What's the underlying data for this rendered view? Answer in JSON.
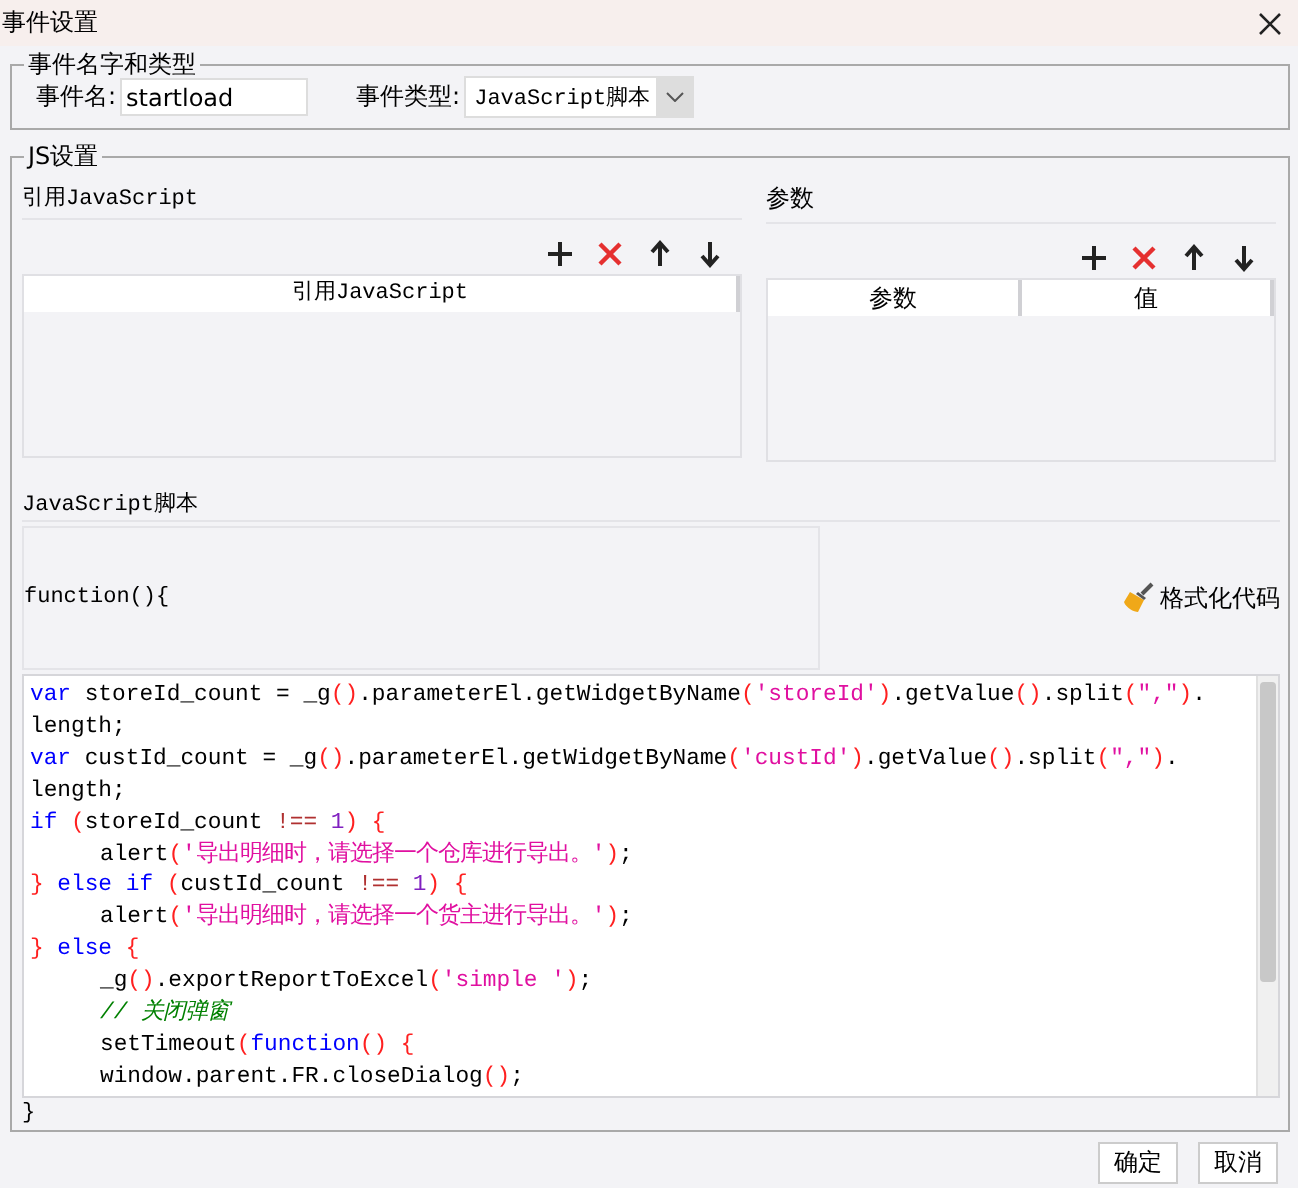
{
  "window": {
    "title": "事件设置"
  },
  "event_group": {
    "title": "事件名字和类型",
    "name_label": "事件名:",
    "name_value": "startload",
    "type_label": "事件类型:",
    "type_value": "JavaScript脚本"
  },
  "js_group": {
    "title": "JS设置",
    "references": {
      "title": "引用JavaScript",
      "columns": [
        "引用JavaScript"
      ]
    },
    "parameters": {
      "title": "参数",
      "columns": [
        "参数",
        "值"
      ]
    },
    "script": {
      "title": "JavaScript脚本",
      "header": "function(){",
      "format_button": "格式化代码",
      "footer": "}",
      "lines": [
        {
          "indent": false,
          "tokens": [
            {
              "kind": "kw",
              "text": "var"
            },
            {
              "kind": "plain",
              "text": " storeId_count = _g"
            },
            {
              "kind": "paren",
              "text": "()"
            },
            {
              "kind": "plain",
              "text": ".parameterEl.getWidgetByName"
            },
            {
              "kind": "paren",
              "text": "("
            },
            {
              "kind": "str",
              "text": "'storeId'"
            },
            {
              "kind": "paren",
              "text": ")"
            },
            {
              "kind": "plain",
              "text": ".getValue"
            },
            {
              "kind": "paren",
              "text": "()"
            },
            {
              "kind": "plain",
              "text": ".split"
            },
            {
              "kind": "paren",
              "text": "("
            },
            {
              "kind": "str",
              "text": "\",\""
            },
            {
              "kind": "paren",
              "text": ")"
            },
            {
              "kind": "plain",
              "text": "."
            }
          ]
        },
        {
          "indent": false,
          "tokens": [
            {
              "kind": "plain",
              "text": "length;"
            }
          ]
        },
        {
          "indent": false,
          "tokens": [
            {
              "kind": "kw",
              "text": "var"
            },
            {
              "kind": "plain",
              "text": " custId_count = _g"
            },
            {
              "kind": "paren",
              "text": "()"
            },
            {
              "kind": "plain",
              "text": ".parameterEl.getWidgetByName"
            },
            {
              "kind": "paren",
              "text": "("
            },
            {
              "kind": "str",
              "text": "'custId'"
            },
            {
              "kind": "paren",
              "text": ")"
            },
            {
              "kind": "plain",
              "text": ".getValue"
            },
            {
              "kind": "paren",
              "text": "()"
            },
            {
              "kind": "plain",
              "text": ".split"
            },
            {
              "kind": "paren",
              "text": "("
            },
            {
              "kind": "str",
              "text": "\",\""
            },
            {
              "kind": "paren",
              "text": ")"
            },
            {
              "kind": "plain",
              "text": "."
            }
          ]
        },
        {
          "indent": false,
          "tokens": [
            {
              "kind": "plain",
              "text": "length;"
            }
          ]
        },
        {
          "indent": false,
          "tokens": [
            {
              "kind": "kw",
              "text": "if"
            },
            {
              "kind": "paren",
              "text": " ("
            },
            {
              "kind": "plain",
              "text": "storeId_count "
            },
            {
              "kind": "op",
              "text": "!=="
            },
            {
              "kind": "num",
              "text": " 1"
            },
            {
              "kind": "paren",
              "text": ")"
            },
            {
              "kind": "paren",
              "text": " {"
            }
          ]
        },
        {
          "indent": true,
          "tokens": [
            {
              "kind": "plain",
              "text": "alert"
            },
            {
              "kind": "paren",
              "text": "("
            },
            {
              "kind": "str",
              "text": "'导出明细时，请选择一个仓库进行导出。'"
            },
            {
              "kind": "paren",
              "text": ")"
            },
            {
              "kind": "plain",
              "text": ";"
            }
          ]
        },
        {
          "indent": false,
          "tokens": [
            {
              "kind": "paren",
              "text": "}"
            },
            {
              "kind": "kw",
              "text": " else if"
            },
            {
              "kind": "paren",
              "text": " ("
            },
            {
              "kind": "plain",
              "text": "custId_count "
            },
            {
              "kind": "op",
              "text": "!=="
            },
            {
              "kind": "num",
              "text": " 1"
            },
            {
              "kind": "paren",
              "text": ")"
            },
            {
              "kind": "paren",
              "text": " {"
            }
          ]
        },
        {
          "indent": true,
          "tokens": [
            {
              "kind": "plain",
              "text": "alert"
            },
            {
              "kind": "paren",
              "text": "("
            },
            {
              "kind": "str",
              "text": "'导出明细时，请选择一个货主进行导出。'"
            },
            {
              "kind": "paren",
              "text": ")"
            },
            {
              "kind": "plain",
              "text": ";"
            }
          ]
        },
        {
          "indent": false,
          "tokens": [
            {
              "kind": "paren",
              "text": "}"
            },
            {
              "kind": "kw",
              "text": " else"
            },
            {
              "kind": "paren",
              "text": " {"
            }
          ]
        },
        {
          "indent": true,
          "tokens": [
            {
              "kind": "plain",
              "text": "_g"
            },
            {
              "kind": "paren",
              "text": "()"
            },
            {
              "kind": "plain",
              "text": ".exportReportToExcel"
            },
            {
              "kind": "paren",
              "text": "("
            },
            {
              "kind": "str",
              "text": "'simple '"
            },
            {
              "kind": "paren",
              "text": ")"
            },
            {
              "kind": "plain",
              "text": ";"
            }
          ]
        },
        {
          "indent": true,
          "tokens": [
            {
              "kind": "comment",
              "text": "// 关闭弹窗"
            }
          ]
        },
        {
          "indent": true,
          "tokens": [
            {
              "kind": "plain",
              "text": "setTimeout"
            },
            {
              "kind": "paren",
              "text": "("
            },
            {
              "kind": "kw",
              "text": "function"
            },
            {
              "kind": "paren",
              "text": "() {"
            }
          ]
        },
        {
          "indent": true,
          "tokens": [
            {
              "kind": "plain",
              "text": "window.parent.FR.closeDialog"
            },
            {
              "kind": "paren",
              "text": "()"
            },
            {
              "kind": "plain",
              "text": ";"
            }
          ]
        }
      ]
    }
  },
  "buttons": [
    "确定",
    "取消"
  ]
}
